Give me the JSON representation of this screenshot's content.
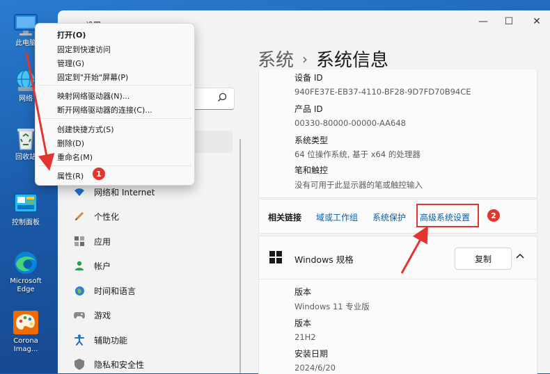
{
  "desktop": {
    "icons": [
      {
        "label": "此电脑"
      },
      {
        "label": "网络"
      },
      {
        "label": "回收站"
      },
      {
        "label": "控制面板"
      },
      {
        "label": "Microsoft Edge"
      },
      {
        "label": "Corona Imag..."
      }
    ]
  },
  "window": {
    "title_partial": "设置",
    "controls": {
      "minimize": "—",
      "maximize": "☐",
      "close": "✕"
    }
  },
  "nav": {
    "items": [
      {
        "label": "网络和 Internet",
        "icon": "wifi-icon"
      },
      {
        "label": "个性化",
        "icon": "pen-icon"
      },
      {
        "label": "应用",
        "icon": "apps-icon"
      },
      {
        "label": "帐户",
        "icon": "account-icon"
      },
      {
        "label": "时间和语言",
        "icon": "globe-icon"
      },
      {
        "label": "游戏",
        "icon": "gamepad-icon"
      },
      {
        "label": "辅助功能",
        "icon": "accessibility-icon"
      },
      {
        "label": "隐私和安全性",
        "icon": "shield-icon"
      }
    ]
  },
  "breadcrumb": {
    "parent": "系统",
    "separator": "›",
    "current": "系统信息"
  },
  "device_info": {
    "partial_label": "设备 ID",
    "device_id": "940FE37E-EB37-4110-BF28-9D7FD70B94CE",
    "product_id_label": "产品 ID",
    "product_id": "00330-80000-00000-AA648",
    "system_type_label": "系统类型",
    "system_type": "64 位操作系统, 基于 x64 的处理器",
    "pen_touch_label": "笔和触控",
    "pen_touch": "没有可用于此显示器的笔或触控输入"
  },
  "related_links": {
    "title": "相关链接",
    "domain": "域或工作组",
    "protection": "系统保护",
    "advanced": "高级系统设置"
  },
  "windows_spec": {
    "title": "Windows 规格",
    "copy_button": "复制",
    "edition_label": "版本",
    "edition": "Windows 11 专业版",
    "version_label": "版本",
    "version": "21H2",
    "install_label": "安装日期",
    "install_date": "2024/6/20"
  },
  "context_menu": {
    "open": "打开(O)",
    "pin_quick": "固定到快速访问",
    "manage": "管理(G)",
    "pin_start": "固定到\"开始\"屏幕(P)",
    "map_drive": "映射网络驱动器(N)...",
    "disconnect_drive": "断开网络驱动器的连接(C)...",
    "create_shortcut": "创建快捷方式(S)",
    "delete": "删除(D)",
    "rename": "重命名(M)",
    "properties": "属性(R)"
  },
  "annotations": {
    "badge1": "1",
    "badge2": "2"
  },
  "colors": {
    "accent": "#005fb8",
    "annotation": "#e3342f"
  }
}
